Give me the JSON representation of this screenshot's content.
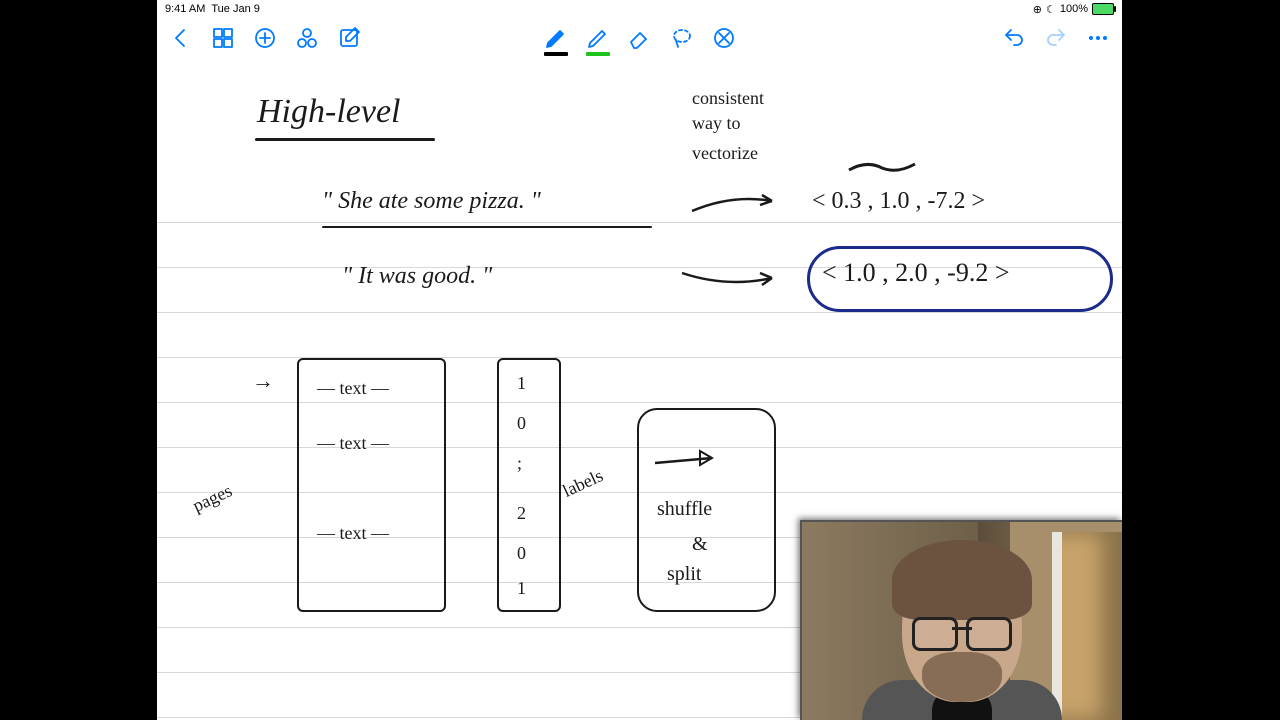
{
  "status": {
    "time": "9:41 AM",
    "date": "Tue Jan 9",
    "battery": "100%"
  },
  "notes": {
    "title": "High-level",
    "vec_note1": "consistent",
    "vec_note2": "way to",
    "vec_note3": "vectorize",
    "sent1": "\" She  ate  some  pizza. \"",
    "sent2": "\" It   was   good. \"",
    "vec1": "< 0.3 ,  1.0 ,  -7.2 >",
    "vec2": "< 1.0 ,  2.0 ,  -9.2 >",
    "pages": "pages",
    "labels": "labels",
    "text1": "— text —",
    "text2": "— text —",
    "text3": "— text —",
    "l1": "1",
    "l2": "0",
    "l3": ";",
    "l4": "2",
    "l5": "0",
    "l6": "1",
    "arrow": "→",
    "shuf1": "shuffle",
    "shuf2": "&",
    "shuf3": "split"
  }
}
